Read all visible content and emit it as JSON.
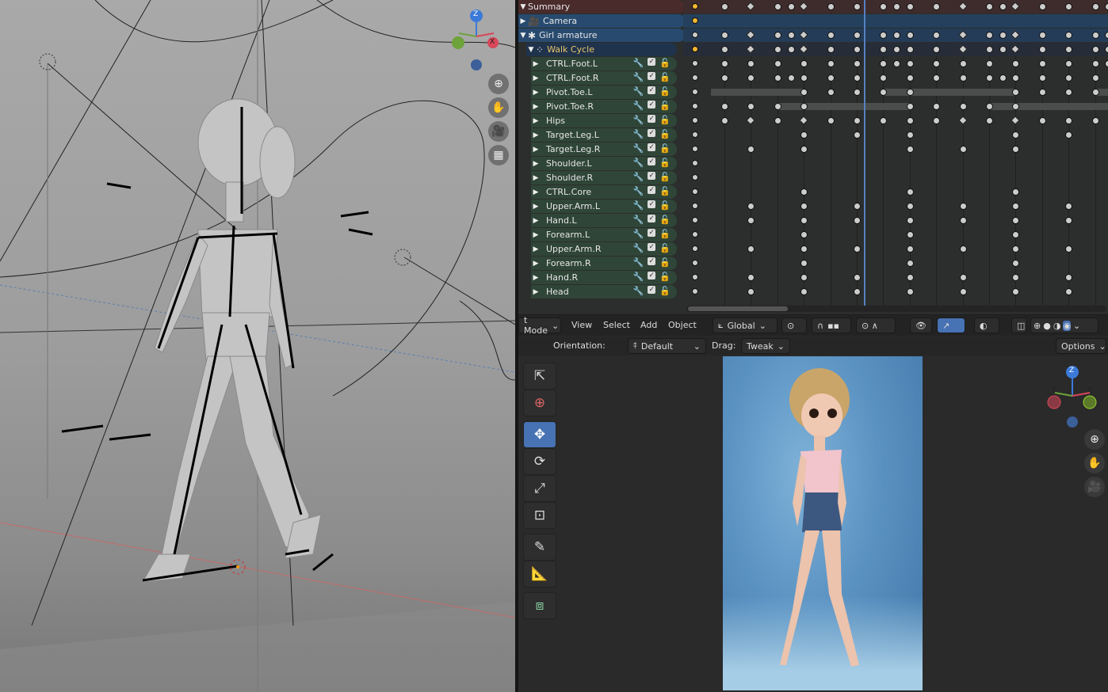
{
  "colors": {
    "accent": "#4772b3",
    "summary_bg": "#4a2b2b",
    "selected_bg": "#284a6f",
    "walk_bg": "#20334c",
    "bone_bg": "#2f4538",
    "playhead": "#5680c2"
  },
  "left_viewport": {
    "nav_icons": [
      "zoom-icon",
      "hand-pan-icon",
      "camera-icon",
      "grid-ortho-icon"
    ],
    "gizmo": {
      "z": "Z",
      "y": "Y",
      "x": "X"
    }
  },
  "dopesheet": {
    "channels": [
      {
        "label": "Summary",
        "kind": "summary",
        "icon": "",
        "lead": "orange"
      },
      {
        "label": "Camera",
        "kind": "object",
        "icon": "camera-icon",
        "lead": "orange"
      },
      {
        "label": "Girl armature",
        "kind": "object",
        "icon": "armature-icon",
        "lead": "white"
      },
      {
        "label": "Walk Cycle",
        "kind": "action",
        "icon": "action-icon",
        "lead": "orange"
      },
      {
        "label": "CTRL.Foot.L",
        "kind": "bone",
        "lead": "white"
      },
      {
        "label": "CTRL.Foot.R",
        "kind": "bone",
        "lead": "white"
      },
      {
        "label": "Pivot.Toe.L",
        "kind": "bone",
        "lead": "white"
      },
      {
        "label": "Pivot.Toe.R",
        "kind": "bone",
        "lead": "white"
      },
      {
        "label": "Hips",
        "kind": "bone",
        "lead": "white"
      },
      {
        "label": "Target.Leg.L",
        "kind": "bone",
        "lead": "white"
      },
      {
        "label": "Target.Leg.R",
        "kind": "bone",
        "lead": "white"
      },
      {
        "label": "Shoulder.L",
        "kind": "bone",
        "lead": "white"
      },
      {
        "label": "Shoulder.R",
        "kind": "bone",
        "lead": "white"
      },
      {
        "label": "CTRL.Core",
        "kind": "bone",
        "lead": "white"
      },
      {
        "label": "Upper.Arm.L",
        "kind": "bone",
        "lead": "white"
      },
      {
        "label": "Hand.L",
        "kind": "bone",
        "lead": "white"
      },
      {
        "label": "Forearm.L",
        "kind": "bone",
        "lead": "white"
      },
      {
        "label": "Upper.Arm.R",
        "kind": "bone",
        "lead": "white"
      },
      {
        "label": "Forearm.R",
        "kind": "bone",
        "lead": "white"
      },
      {
        "label": "Hand.R",
        "kind": "bone",
        "lead": "white"
      },
      {
        "label": "Head",
        "kind": "bone",
        "lead": "white"
      }
    ],
    "keyframes": [
      {
        "frames": [
          0,
          2,
          4,
          5,
          6,
          8,
          10,
          12,
          13,
          14,
          16,
          18,
          20,
          21,
          22,
          24,
          26,
          28,
          29
        ],
        "diamonds": [
          2,
          6,
          18,
          22
        ]
      },
      {
        "frames": [],
        "diamonds": []
      },
      {
        "frames": [
          0,
          2,
          4,
          5,
          6,
          8,
          10,
          12,
          13,
          14,
          16,
          18,
          20,
          21,
          22,
          24,
          26,
          28,
          29
        ],
        "diamonds": [
          2,
          6,
          18,
          22
        ]
      },
      {
        "frames": [
          0,
          2,
          4,
          5,
          6,
          8,
          10,
          12,
          13,
          14,
          16,
          18,
          20,
          21,
          22,
          24,
          26,
          28,
          29
        ],
        "diamonds": [
          2,
          6,
          18,
          22
        ]
      },
      {
        "frames": [
          0,
          2,
          4,
          6,
          8,
          10,
          12,
          13,
          14,
          16,
          18,
          20,
          22,
          24,
          26,
          28,
          29
        ],
        "diamonds": []
      },
      {
        "frames": [
          0,
          2,
          4,
          5,
          6,
          8,
          10,
          12,
          14,
          16,
          18,
          20,
          21,
          22,
          24,
          26,
          28
        ],
        "diamonds": []
      },
      {
        "frames": [
          6,
          8,
          10,
          12,
          14,
          22,
          24,
          26,
          28
        ],
        "diamonds": [],
        "holds": [
          [
            -1,
            6
          ],
          [
            12,
            14
          ],
          [
            14,
            22
          ],
          [
            28,
            30
          ]
        ]
      },
      {
        "frames": [
          0,
          2,
          4,
          6,
          14,
          16,
          18,
          20,
          22
        ],
        "diamonds": [],
        "holds": [
          [
            4,
            14
          ],
          [
            20,
            30
          ]
        ]
      },
      {
        "frames": [
          0,
          2,
          4,
          6,
          8,
          10,
          12,
          14,
          16,
          18,
          20,
          22,
          24,
          26,
          28
        ],
        "diamonds": [
          2,
          6,
          18,
          22
        ]
      },
      {
        "frames": [
          6,
          10,
          14,
          22,
          26
        ],
        "diamonds": []
      },
      {
        "frames": [
          2,
          6,
          14,
          18,
          22
        ],
        "diamonds": []
      },
      {
        "frames": [],
        "diamonds": []
      },
      {
        "frames": [],
        "diamonds": []
      },
      {
        "frames": [
          6,
          14,
          22
        ],
        "diamonds": []
      },
      {
        "frames": [
          2,
          6,
          10,
          14,
          18,
          22,
          26
        ],
        "diamonds": []
      },
      {
        "frames": [
          2,
          6,
          10,
          14,
          18,
          22,
          26
        ],
        "diamonds": []
      },
      {
        "frames": [
          6,
          14,
          22
        ],
        "diamonds": []
      },
      {
        "frames": [
          2,
          6,
          10,
          14,
          18,
          22,
          26
        ],
        "diamonds": []
      },
      {
        "frames": [
          6,
          14,
          22
        ],
        "diamonds": []
      },
      {
        "frames": [
          2,
          6,
          10,
          14,
          18,
          22,
          26
        ],
        "diamonds": []
      },
      {
        "frames": [
          2,
          6,
          10,
          14,
          18,
          22,
          26
        ],
        "diamonds": []
      }
    ]
  },
  "viewport": {
    "header": {
      "mode": "t Mode",
      "menus": [
        "View",
        "Select",
        "Add",
        "Object"
      ],
      "orientation": "Global"
    },
    "tool_settings": {
      "orientation_label": "Orientation:",
      "orientation_value": "Default",
      "drag_label": "Drag:",
      "drag_value": "Tweak",
      "options": "Options"
    },
    "tools": [
      "select-box-icon",
      "cursor-icon",
      "move-icon",
      "rotate-icon",
      "scale-icon",
      "transform-icon",
      "annotate-icon",
      "measure-icon",
      "add-cube-icon"
    ],
    "active_tool": "move-icon",
    "gizmo": {
      "z": "Z",
      "y": "Y",
      "x": "X"
    }
  }
}
